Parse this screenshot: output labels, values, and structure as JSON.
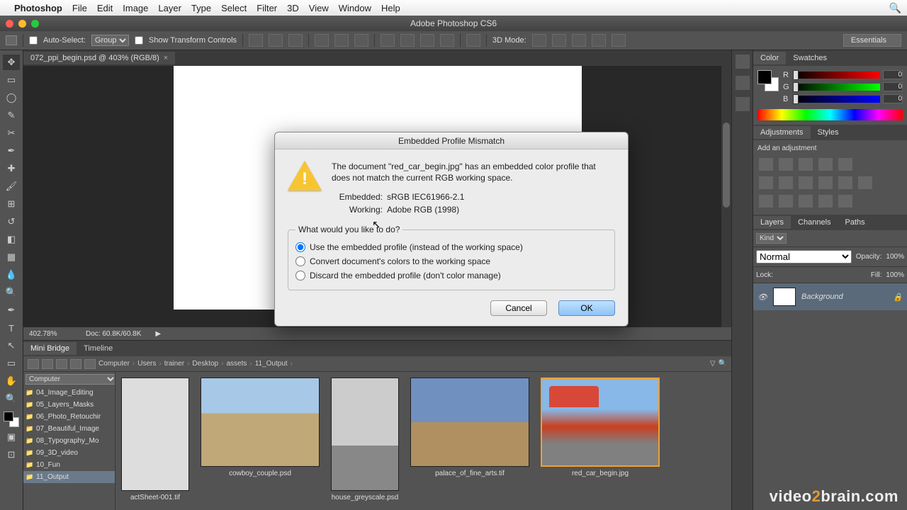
{
  "menubar": {
    "app": "Photoshop",
    "items": [
      "File",
      "Edit",
      "Image",
      "Layer",
      "Type",
      "Select",
      "Filter",
      "3D",
      "View",
      "Window",
      "Help"
    ]
  },
  "window": {
    "title": "Adobe Photoshop CS6"
  },
  "optionsbar": {
    "autoselect": "Auto-Select:",
    "group": "Group",
    "show_transform": "Show Transform Controls",
    "mode3d": "3D Mode:",
    "workspace": "Essentials"
  },
  "doc_tab": {
    "label": "072_ppi_begin.psd @ 403% (RGB/8)"
  },
  "status": {
    "zoom": "402.78%",
    "doc": "Doc: 60.8K/60.8K"
  },
  "minibridge": {
    "tabs": [
      "Mini Bridge",
      "Timeline"
    ],
    "path": [
      "Computer",
      "Users",
      "trainer",
      "Desktop",
      "assets",
      "11_Output"
    ],
    "source": "Computer",
    "folders": [
      "04_Image_Editing",
      "05_Layers_Masks",
      "06_Photo_Retouchir",
      "07_Beautiful_Image",
      "08_Typography_Mo",
      "09_3D_video",
      "10_Fun",
      "11_Output"
    ],
    "thumbs": [
      {
        "label": "actSheet-001.tif",
        "cls": "sheet"
      },
      {
        "label": "cowboy_couple.psd",
        "cls": "cowboy"
      },
      {
        "label": "house_greyscale.psd",
        "cls": "house"
      },
      {
        "label": "palace_of_fine_arts.tif",
        "cls": "palace"
      },
      {
        "label": "red_car_begin.jpg",
        "cls": "car",
        "selected": true
      }
    ]
  },
  "color_panel": {
    "tabs": [
      "Color",
      "Swatches"
    ],
    "r": "0",
    "g": "0",
    "b": "0",
    "labels": {
      "r": "R",
      "g": "G",
      "b": "B"
    }
  },
  "adjustments": {
    "tabs": [
      "Adjustments",
      "Styles"
    ],
    "hint": "Add an adjustment"
  },
  "layers": {
    "tabs": [
      "Layers",
      "Channels",
      "Paths"
    ],
    "kind": "Kind",
    "blend": "Normal",
    "opacity_label": "Opacity:",
    "opacity": "100%",
    "lock_label": "Lock:",
    "fill_label": "Fill:",
    "fill": "100%",
    "layer0": "Background"
  },
  "dialog": {
    "title": "Embedded Profile Mismatch",
    "message": "The document \"red_car_begin.jpg\" has an embedded color profile that does not match the current RGB working space.",
    "embedded_k": "Embedded:",
    "embedded_v": "sRGB IEC61966-2.1",
    "working_k": "Working:",
    "working_v": "Adobe RGB (1998)",
    "legend": "What would you like to do?",
    "opt1": "Use the embedded profile (instead of the working space)",
    "opt2": "Convert document's colors to the working space",
    "opt3": "Discard the embedded profile (don't color manage)",
    "cancel": "Cancel",
    "ok": "OK"
  },
  "watermark": {
    "a": "video",
    "b": "2",
    "c": "brain.com"
  }
}
